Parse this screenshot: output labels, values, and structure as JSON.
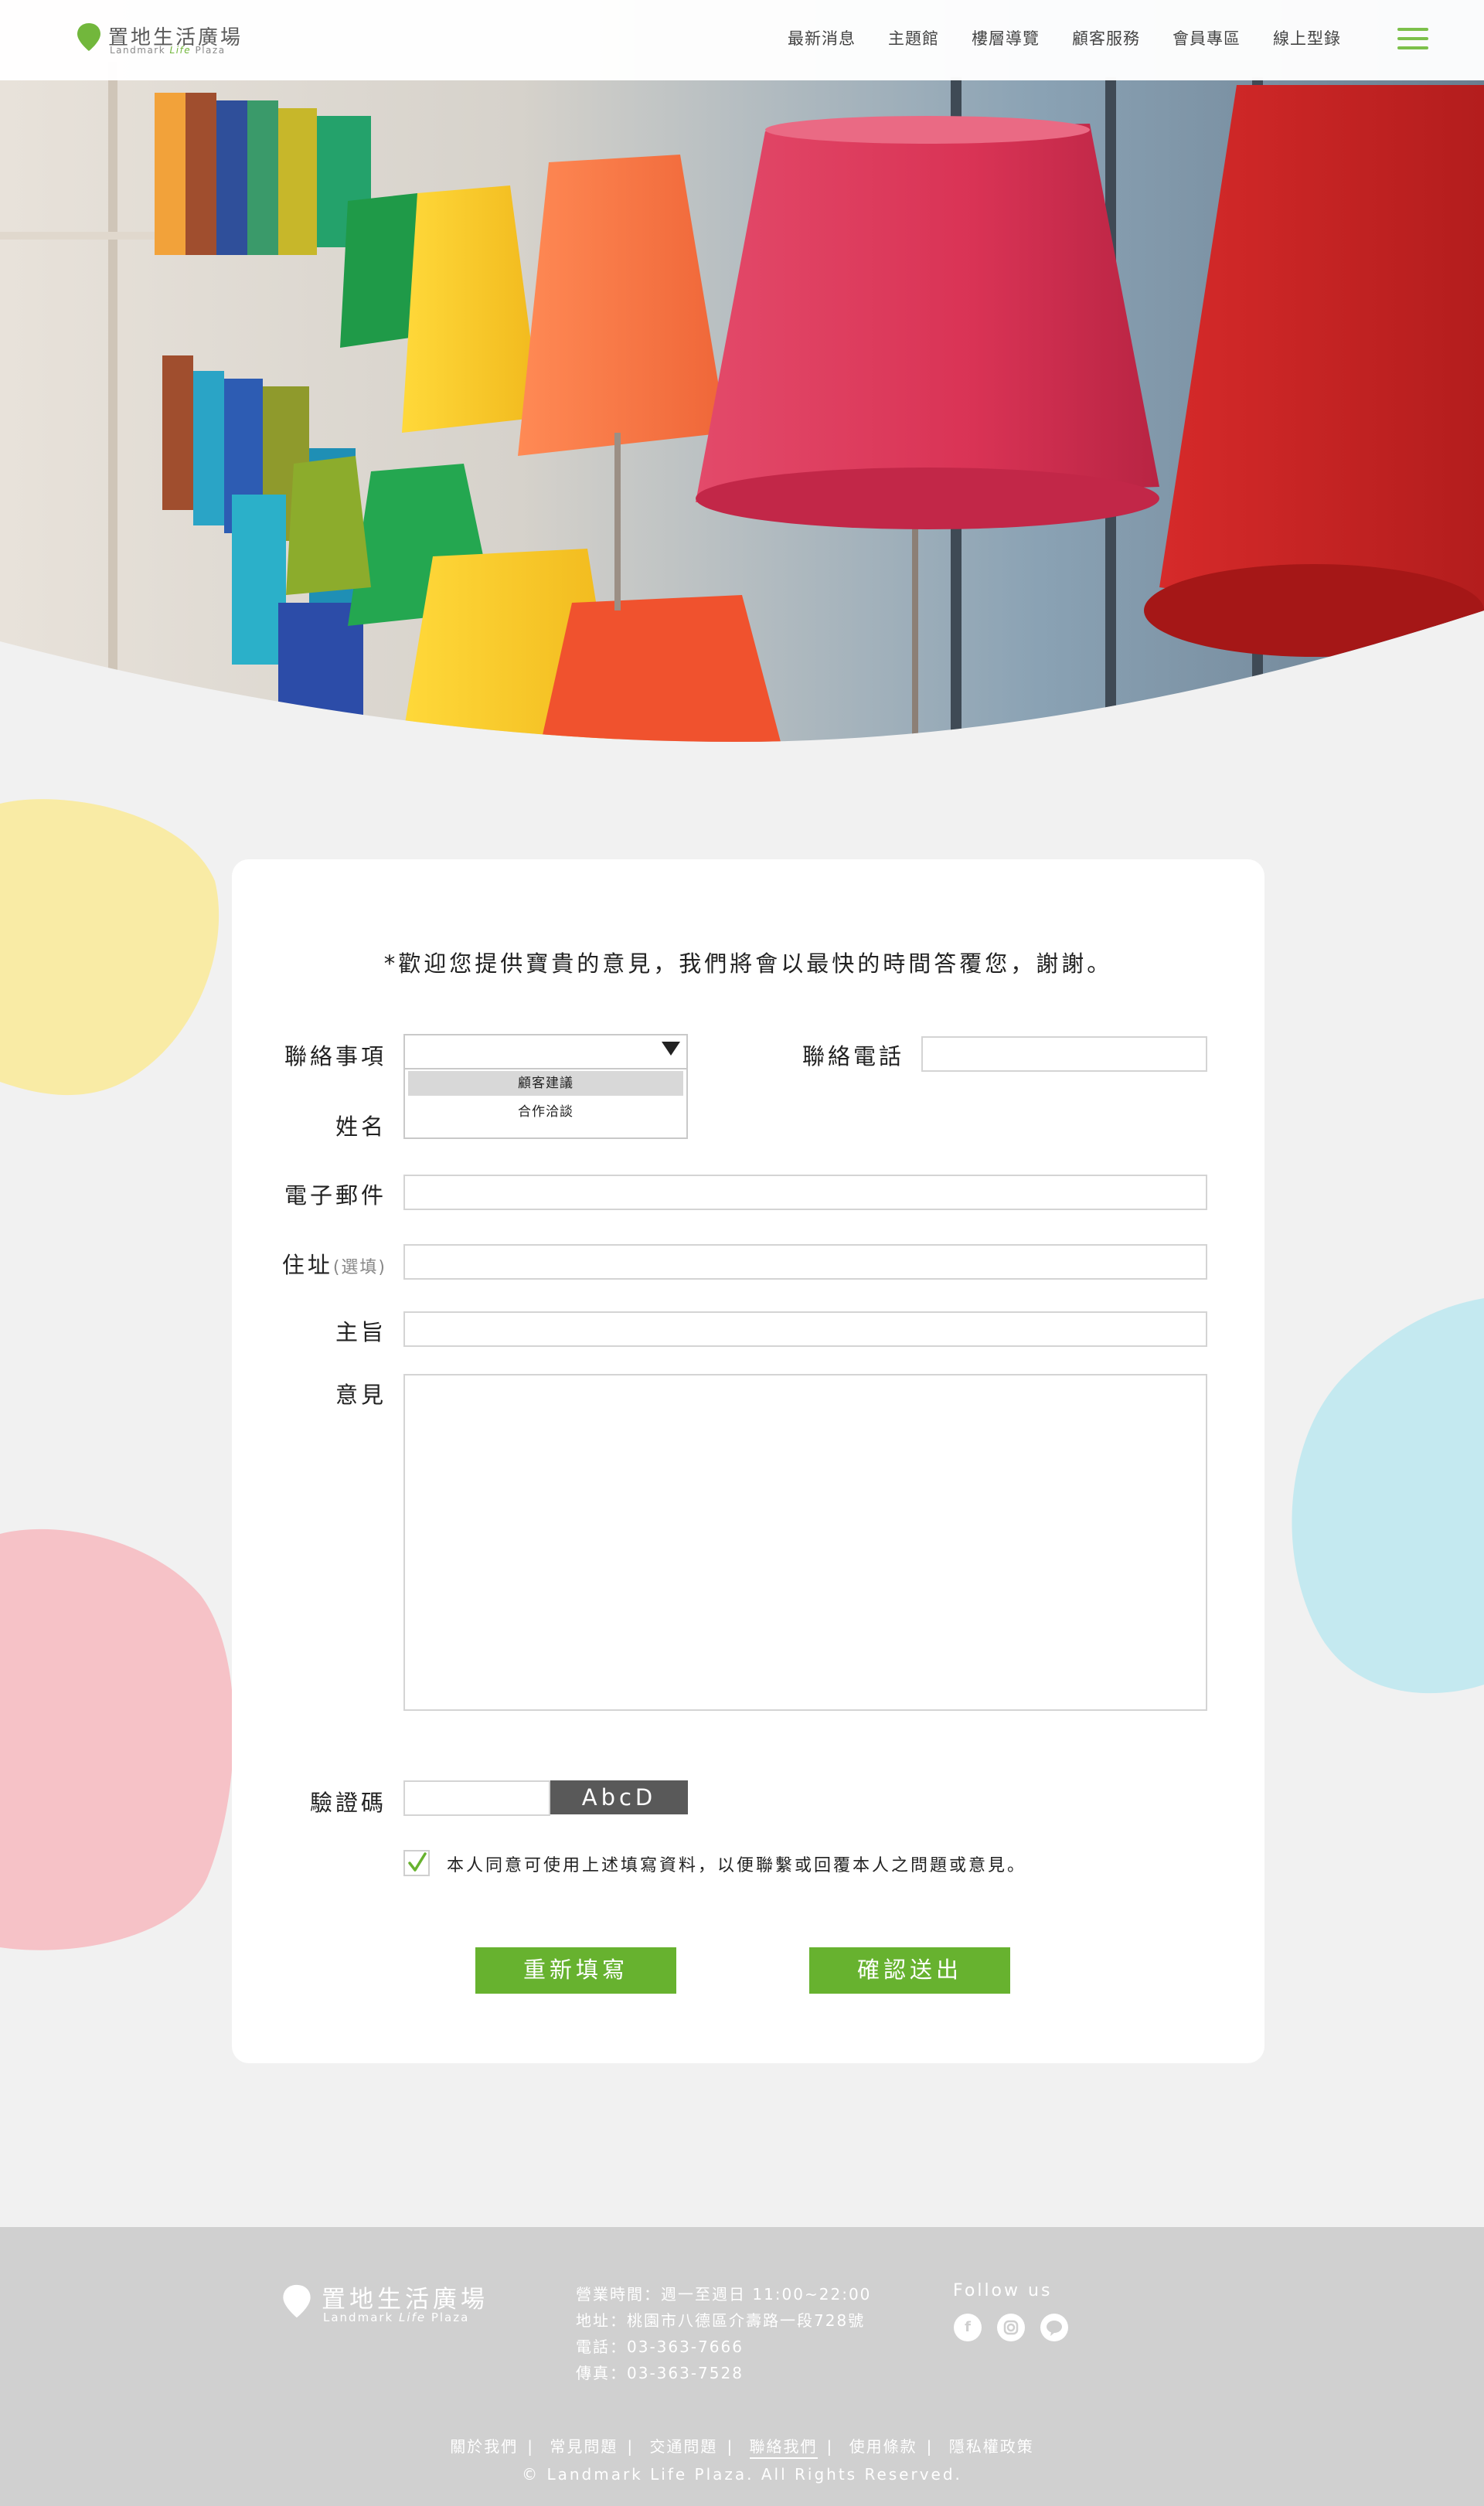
{
  "brand": {
    "name": "置地生活廣場",
    "sub_prefix": "Landmark ",
    "sub_life": "Life",
    "sub_suffix": " Plaza",
    "accent": "#72b73c",
    "button_color": "#67b22f"
  },
  "nav": {
    "items": [
      "最新消息",
      "主題館",
      "樓層導覽",
      "顧客服務",
      "會員專區",
      "線上型錄"
    ],
    "menu_icon": "hamburger-icon"
  },
  "form": {
    "intro": "*歡迎您提供寶貴的意見，我們將會以最快的時間答覆您，謝謝。",
    "labels": {
      "subject": "聯絡事項",
      "phone": "聯絡電話",
      "name": "姓名",
      "email": "電子郵件",
      "address": "住址",
      "address_optional": "(選填)",
      "topic": "主旨",
      "message": "意見",
      "captcha": "驗證碼"
    },
    "subject_options": [
      "顧客建議",
      "合作洽談"
    ],
    "subject_selected": "顧客建議",
    "captcha_text": "AbcD",
    "agree_checked": true,
    "agree_text": "本人同意可使用上述填寫資料，以便聯繫或回覆本人之問題或意見。",
    "reset_label": "重新填寫",
    "submit_label": "確認送出"
  },
  "footer": {
    "logo_name": "置地生活廣場",
    "logo_sub_prefix": "Landmark ",
    "logo_sub_life": "Life",
    "logo_sub_suffix": " Plaza",
    "hours": "營業時間：週一至週日 11:00~22:00",
    "address": "地址：桃園市八德區介壽路一段728號",
    "tel": "電話：03-363-7666",
    "fax": "傳真：03-363-7528",
    "follow": "Follow us",
    "social": [
      "facebook-icon",
      "instagram-icon",
      "line-icon"
    ],
    "links": [
      "關於我們",
      "常見問題",
      "交通問題",
      "聯絡我們",
      "使用條款",
      "隱私權政策"
    ],
    "active_link": "聯絡我們",
    "copyright": "© Landmark Life Plaza. All Rights Reserved."
  }
}
